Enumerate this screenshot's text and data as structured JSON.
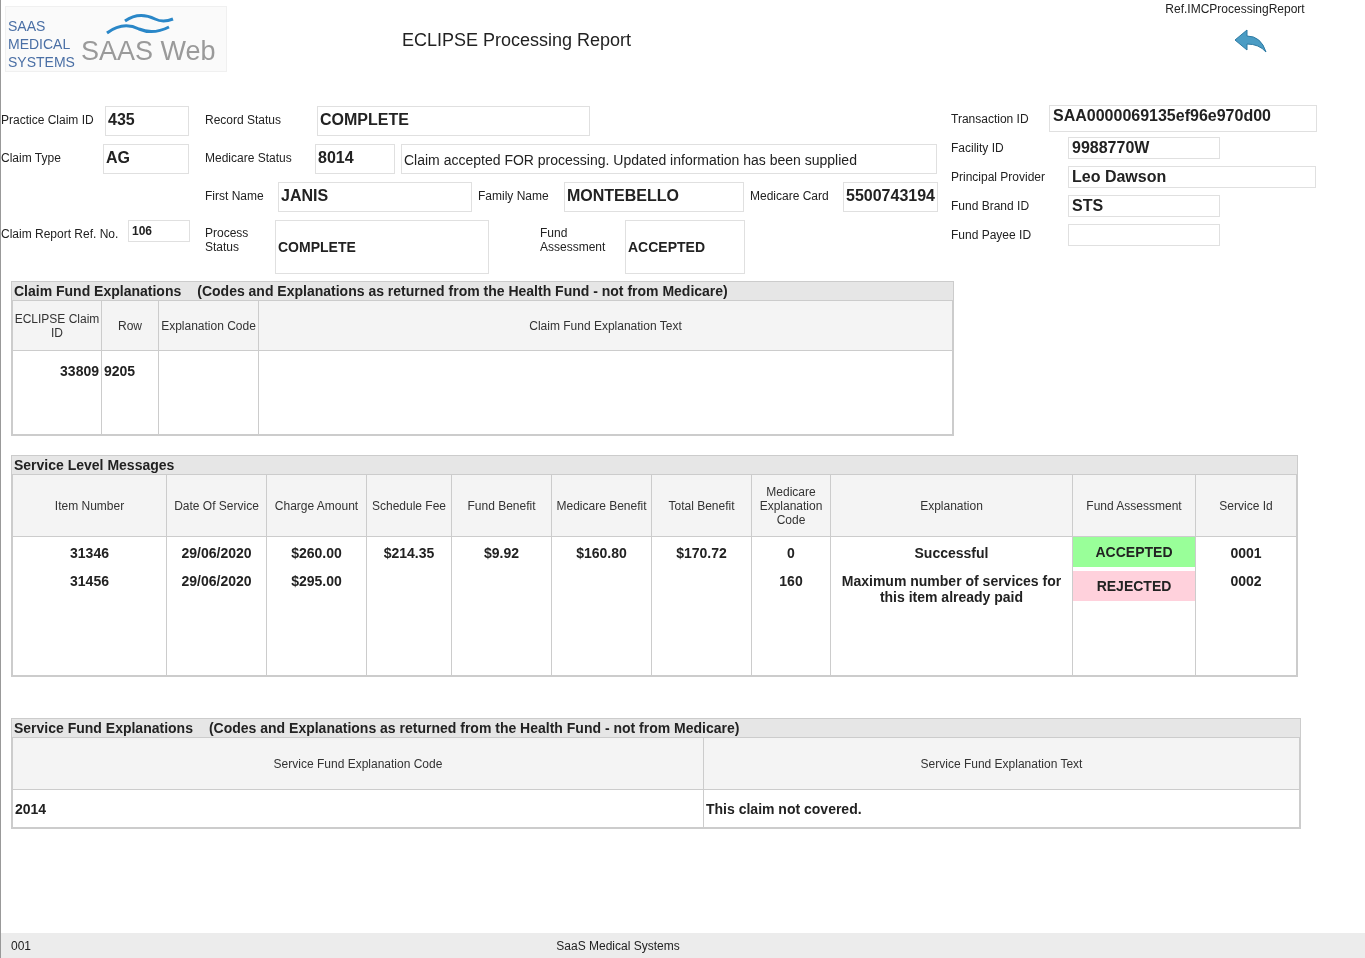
{
  "logo": {
    "company_lines": [
      "SAAS",
      "MEDICAL",
      "SYSTEMS"
    ],
    "product": "SAAS Web"
  },
  "title": "ECLIPSE Processing Report",
  "report_ref": "Ref.IMCProcessingReport",
  "left_fields": [
    {
      "label": "Practice Claim ID",
      "value": "435"
    },
    {
      "label": "Claim Type",
      "value": "AG"
    },
    {
      "label": "Claim Report Ref. No.",
      "value": "106"
    }
  ],
  "mid_rows": [
    [
      {
        "label": "Record Status",
        "value": "COMPLETE"
      }
    ],
    [
      {
        "label": "Medicare Status",
        "value": "8014",
        "message": "Claim accepted FOR processing. Updated information has been supplied"
      }
    ],
    [
      {
        "label": "First Name",
        "value": "JANIS"
      },
      {
        "label": "Family Name",
        "value": "MONTEBELLO"
      },
      {
        "label": "Medicare Card",
        "value": "5500743194"
      }
    ],
    [
      {
        "label": "Process Status",
        "value": "COMPLETE"
      },
      {
        "label": "Fund Assessment",
        "value": "ACCEPTED"
      }
    ]
  ],
  "right_fields": [
    {
      "label": "Transaction ID",
      "value": "SAA0000069135ef96e970d00"
    },
    {
      "label": "Facility ID",
      "value": "9988770W"
    },
    {
      "label": "Principal Provider",
      "value": "Leo Dawson"
    },
    {
      "label": "Fund Brand ID",
      "value": "STS"
    },
    {
      "label": "Fund Payee ID"
    }
  ],
  "claim_fund": {
    "title": "Claim Fund Explanations",
    "subtitle": "(Codes and Explanations as returned from the Health Fund - not from Medicare)",
    "columns": [
      "ECLIPSE Claim ID",
      "Row",
      "Explanation Code",
      "Claim Fund Explanation Text"
    ],
    "rows": [
      {
        "claim_id": "33809",
        "row": "9205"
      }
    ]
  },
  "service_level": {
    "title": "Service Level Messages",
    "columns": [
      "Item Number",
      "Date Of Service",
      "Charge Amount",
      "Schedule Fee",
      "Fund Benefit",
      "Medicare Benefit",
      "Total Benefit",
      "Medicare Explanation Code",
      "Explanation",
      "Fund Assessment",
      "Service Id"
    ],
    "rows": [
      {
        "item": "31346",
        "date": "29/06/2020",
        "charge": "$260.00",
        "schedule_fee": "$214.35",
        "fund_benefit": "$9.92",
        "medicare_benefit": "$160.80",
        "total_benefit": "$170.72",
        "medicare_code": "0",
        "explanation": "Successful",
        "fund_assessment": "ACCEPTED",
        "color": "#99ff99",
        "service_id": "0001"
      },
      {
        "item": "31456",
        "date": "29/06/2020",
        "charge": "$295.00",
        "medicare_code": "160",
        "explanation": "Maximum number of services for this item already paid",
        "fund_assessment": "REJECTED",
        "color": "#ffd1dc",
        "service_id": "0002"
      }
    ]
  },
  "service_fund": {
    "title": "Service Fund Explanations",
    "subtitle": "(Codes and Explanations as returned from the Health Fund - not from Medicare)",
    "columns": [
      "Service Fund Explanation Code",
      "Service Fund Explanation Text"
    ],
    "rows": [
      {
        "code": "2014",
        "text": "This claim not covered."
      }
    ]
  },
  "footer": {
    "page": "001",
    "company": "SaaS Medical Systems"
  }
}
